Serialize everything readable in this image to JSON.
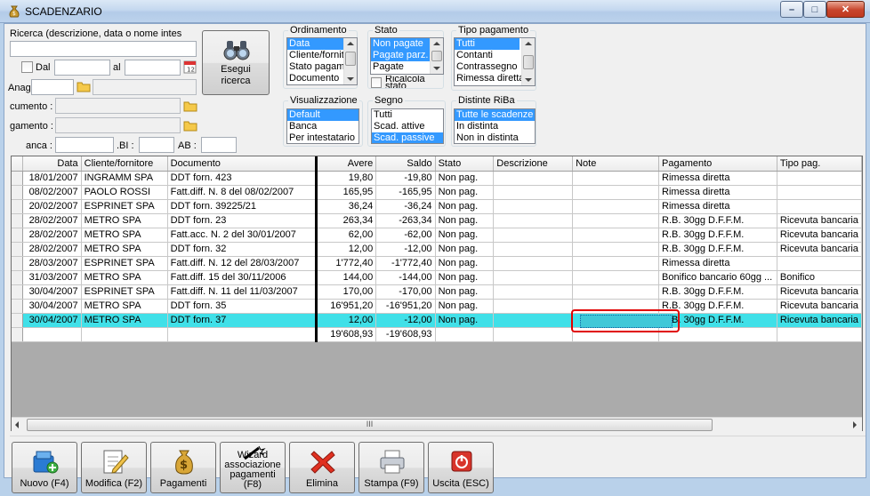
{
  "window": {
    "title": "SCADENZARIO",
    "minimize": "–",
    "maximize": "□",
    "close": "✕"
  },
  "search": {
    "label": "Ricerca (descrizione, data o nome intes",
    "value": "",
    "dal_label": "Dal",
    "al_label": "al",
    "anag_label": "Anag",
    "documento_label": "cumento :",
    "pagamento_label": "gamento :",
    "banca_label": "anca :",
    "abi_label": ".BI :",
    "cab_label": "AB :",
    "button_line1": "Esegui",
    "button_line2": "ricerca"
  },
  "ordinamento": {
    "title": "Ordinamento",
    "items": [
      "Data",
      "Cliente/fornit",
      "Stato pagam",
      "Documento"
    ],
    "selected": 0
  },
  "stato": {
    "title": "Stato",
    "items": [
      "Non pagate",
      "Pagate parz.",
      "Pagate"
    ],
    "ricalcola_label": "Ricalcola stato"
  },
  "tipo_pagamento": {
    "title": "Tipo pagamento",
    "items": [
      "Tutti",
      "Contanti",
      "Contrassegno",
      "Rimessa diretta"
    ]
  },
  "visualizzazione": {
    "title": "Visualizzazione",
    "items": [
      "Default",
      "Banca",
      "Per intestatario"
    ]
  },
  "segno": {
    "title": "Segno",
    "items": [
      "Tutti",
      "Scad. attive",
      "Scad. passive"
    ]
  },
  "distinte": {
    "title": "Distinte RiBa",
    "items": [
      "Tutte le scadenze",
      "In distinta",
      "Non in distinta"
    ]
  },
  "grid": {
    "columns": [
      "Data",
      "Cliente/fornitore",
      "Documento",
      "Avere",
      "Saldo",
      "Stato",
      "Descrizione",
      "Note",
      "Pagamento",
      "Tipo pag."
    ],
    "rows": [
      [
        "18/01/2007",
        "INGRAMM SPA",
        "DDT forn. 423",
        "19,80",
        "-19,80",
        "Non pag.",
        "",
        "",
        "Rimessa diretta",
        ""
      ],
      [
        "08/02/2007",
        "PAOLO ROSSI",
        "Fatt.diff. N. 8 del 08/02/2007",
        "165,95",
        "-165,95",
        "Non pag.",
        "",
        "",
        "Rimessa diretta",
        ""
      ],
      [
        "20/02/2007",
        "ESPRINET SPA",
        "DDT forn. 39225/21",
        "36,24",
        "-36,24",
        "Non pag.",
        "",
        "",
        "Rimessa diretta",
        ""
      ],
      [
        "28/02/2007",
        "METRO SPA",
        "DDT forn. 23",
        "263,34",
        "-263,34",
        "Non pag.",
        "",
        "",
        "R.B. 30gg D.F.F.M.",
        "Ricevuta bancaria"
      ],
      [
        "28/02/2007",
        "METRO SPA",
        "Fatt.acc. N. 2 del 30/01/2007",
        "62,00",
        "-62,00",
        "Non pag.",
        "",
        "",
        "R.B. 30gg D.F.F.M.",
        "Ricevuta bancaria"
      ],
      [
        "28/02/2007",
        "METRO SPA",
        "DDT forn. 32",
        "12,00",
        "-12,00",
        "Non pag.",
        "",
        "",
        "R.B. 30gg D.F.F.M.",
        "Ricevuta bancaria"
      ],
      [
        "28/03/2007",
        "ESPRINET SPA",
        "Fatt.diff. N. 12 del 28/03/2007",
        "1'772,40",
        "-1'772,40",
        "Non pag.",
        "",
        "",
        "Rimessa diretta",
        ""
      ],
      [
        "31/03/2007",
        "METRO SPA",
        "Fatt.diff. 15 del 30/11/2006",
        "144,00",
        "-144,00",
        "Non pag.",
        "",
        "",
        "Bonifico bancario 60gg ...",
        "Bonifico"
      ],
      [
        "30/04/2007",
        "ESPRINET SPA",
        "Fatt.diff. N. 11 del 11/03/2007",
        "170,00",
        "-170,00",
        "Non pag.",
        "",
        "",
        "R.B. 30gg D.F.F.M.",
        "Ricevuta bancaria"
      ],
      [
        "30/04/2007",
        "METRO SPA",
        "DDT forn. 35",
        "16'951,20",
        "-16'951,20",
        "Non pag.",
        "",
        "",
        "R.B. 30gg D.F.F.M.",
        "Ricevuta bancaria"
      ],
      [
        "30/04/2007",
        "METRO SPA",
        "DDT forn. 37",
        "12,00",
        "-12,00",
        "Non pag.",
        "",
        "",
        "R.B. 30gg D.F.F.M.",
        "Ricevuta bancaria"
      ]
    ],
    "selected_row": 10,
    "totals": {
      "avere": "19'608,93",
      "saldo": "-19'608,93"
    },
    "scroll_grip": "III"
  },
  "toolbar": {
    "nuovo": "Nuovo (F4)",
    "modifica": "Modifica (F2)",
    "pagamenti": "Pagamenti",
    "wizard": "Wizard associazione pagamenti (F8)",
    "elimina": "Elimina",
    "stampa": "Stampa (F9)",
    "uscita": "Uscita (ESC)"
  }
}
